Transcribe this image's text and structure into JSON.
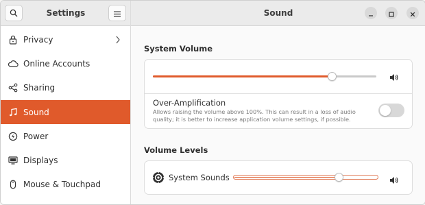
{
  "sidebar": {
    "title": "Settings",
    "search_icon": "search-icon",
    "menu_icon": "hamburger-menu-icon",
    "items": [
      {
        "label": "Privacy",
        "icon": "lock-icon",
        "has_chevron": true,
        "active": false
      },
      {
        "label": "Online Accounts",
        "icon": "cloud-icon",
        "active": false
      },
      {
        "label": "Sharing",
        "icon": "share-icon",
        "active": false
      },
      {
        "label": "Sound",
        "icon": "music-note-icon",
        "active": true
      },
      {
        "label": "Power",
        "icon": "power-icon",
        "active": false
      },
      {
        "label": "Displays",
        "icon": "display-icon",
        "active": false
      },
      {
        "label": "Mouse & Touchpad",
        "icon": "mouse-icon",
        "active": false
      }
    ]
  },
  "header": {
    "title": "Sound",
    "window_controls": [
      "minimize-icon",
      "maximize-icon",
      "close-icon"
    ]
  },
  "system_volume": {
    "section_title": "System Volume",
    "volume_fraction": 0.8,
    "speaker_icon": "speaker-icon",
    "over_amplification": {
      "title": "Over-Amplification",
      "description_line1": "Allows raising the volume above 100%. This can result in a loss of audio",
      "description_line2": "quality; it is better to increase application volume settings, if possible.",
      "enabled": false
    }
  },
  "volume_levels": {
    "section_title": "Volume Levels",
    "items": [
      {
        "label": "System Sounds",
        "icon": "system-sounds-icon",
        "volume_fraction": 0.73
      }
    ]
  },
  "colors": {
    "accent": "#e05a2b",
    "sidebar_bg": "#ffffff",
    "header_bg": "#ebebeb"
  }
}
